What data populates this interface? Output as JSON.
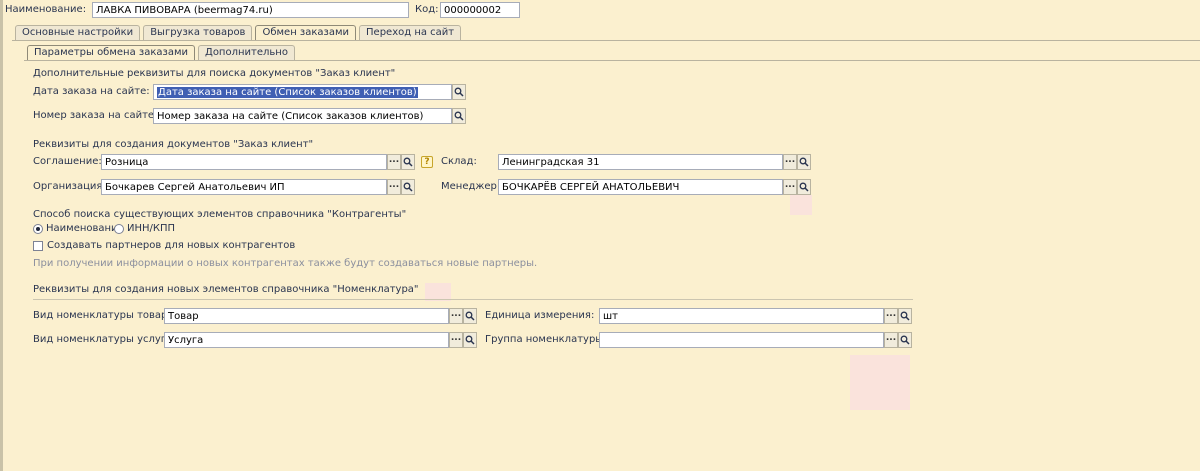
{
  "header": {
    "name_label": "Наименование:",
    "name_value": "ЛАВКА ПИВОВАРА (beermag74.ru)",
    "code_label": "Код:",
    "code_value": "000000002"
  },
  "tabs": [
    {
      "label": "Основные настройки",
      "active": false
    },
    {
      "label": "Выгрузка товаров",
      "active": false
    },
    {
      "label": "Обмен заказами",
      "active": true
    },
    {
      "label": "Переход на сайт",
      "active": false
    }
  ],
  "subtabs": [
    {
      "label": "Параметры обмена заказами",
      "active": true
    },
    {
      "label": "Дополнительно",
      "active": false
    }
  ],
  "search_section": {
    "title": "Дополнительные реквизиты для поиска документов \"Заказ клиент\"",
    "order_date_label": "Дата заказа на сайте:",
    "order_date_value": "Дата заказа на сайте (Список заказов клиентов)",
    "order_number_label": "Номер заказа на сайте:",
    "order_number_value": "Номер заказа на сайте (Список заказов клиентов)"
  },
  "create_section": {
    "title": "Реквизиты для создания документов \"Заказ клиент\"",
    "agreement_label": "Соглашение:",
    "agreement_value": "Розница",
    "organization_label": "Организация:",
    "organization_value": "Бочкарев Сергей Анатольевич ИП",
    "warehouse_label": "Склад:",
    "warehouse_value": "Ленинградская 31",
    "manager_label": "Менеджер:",
    "manager_value": "БОЧКАРЁВ СЕРГЕЙ АНАТОЛЬЕВИЧ",
    "help_glyph": "?"
  },
  "contractor_section": {
    "title": "Способ поиска существующих элементов справочника \"Контрагенты\"",
    "option_name": "Наименование",
    "option_inn": "ИНН/КПП",
    "selected": "Наименование",
    "create_partners_label": "Создавать партнеров для новых контрагентов",
    "create_partners_checked": false,
    "hint": "При получении информации о новых контрагентах также будут создаваться новые партнеры."
  },
  "nomenclature_section": {
    "title": "Реквизиты для создания новых элементов справочника \"Номенклатура\"",
    "goods_type_label": "Вид номенклатуры товар:",
    "goods_type_value": "Товар",
    "service_type_label": "Вид номенклатуры услуга:",
    "service_type_value": "Услуга",
    "unit_label": "Единица измерения:",
    "unit_value": "шт",
    "group_label": "Группа номенклатуры:",
    "group_value": ""
  },
  "icons": {
    "select": "ellipsis-icon",
    "open": "magnifier-icon"
  },
  "colors": {
    "background": "#fbf0cf",
    "selection": "#3f5fb3",
    "help": "#c7a52b"
  }
}
